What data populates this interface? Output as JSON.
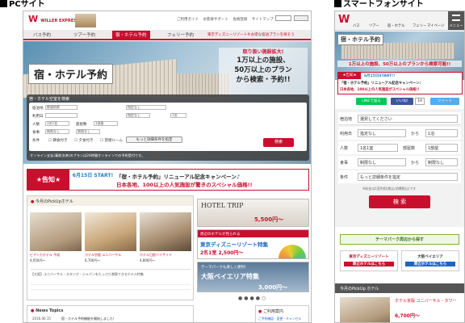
{
  "headings": {
    "pc": "PCサイト",
    "sp": "スマートフォンサイト"
  },
  "pc": {
    "logo": "WILLER EXPRESS",
    "top_links": [
      "ご利用ガイド",
      "お客様サポート",
      "会員登録",
      "サイトマップ"
    ],
    "nav": [
      "バス予約",
      "ツアー予約",
      "宿・ホテル予約",
      "フェリー予約",
      "東京ディズニーリゾート®お得な宿泊プランを探そう"
    ],
    "hero": {
      "title": "宿・ホテル予約",
      "promo": [
        "取り扱い施設拡大!",
        "1万以上の施設、",
        "50万以上のプラン",
        "から検索・予約!!"
      ]
    },
    "search": {
      "title": "宿・ホテル空室を検索",
      "fields": {
        "pref_label": "宿泊地",
        "pref_value": "都道府県",
        "area_value": "指定なし",
        "date_label": "利用日",
        "date_value": "指定なし",
        "nights_value": "1泊",
        "people_label": "人数",
        "people_value": "1名1室",
        "rooms_label": "部屋数",
        "rooms_value": "1部屋",
        "meal_label": "食事",
        "meal_value": "制限なし",
        "budget_value": "制限なし",
        "cond_label": "条件",
        "cond_values": [
          "朝食付き",
          "夕食付き",
          "禁煙ルーム"
        ],
        "more": "もっと詳細条件を指定"
      },
      "button": "検索",
      "note": "オンライン支払(事前決済)のプランは24時間オンラインでの予約受付です。"
    },
    "banner": {
      "tag": "★告知★",
      "date": "6月15日 START!",
      "line1": "「宿・ホテル予約」リニューアル記念キャンペーン♪",
      "line2": "日本各地、100以上の人気施設が驚きのスペシャル価格!!"
    },
    "pickup": {
      "title": "今月のPickUpホテル",
      "items": [
        {
          "name": "ビアンカホテル 平成",
          "price": "4,050円〜"
        },
        {
          "name": "ホテル京阪 ユニバーサル",
          "price": "6,700円〜"
        },
        {
          "name": "ホテル日航ベイサイド",
          "price": "4,800円〜"
        }
      ],
      "desc": "【大阪】ユニバーサル・スタジオ・ジャパンをたっぷり満喫できるホテル特集"
    },
    "side_banners": {
      "hoteltrip": "HOTEL TRIP",
      "hoteltrip_price": "5,500円〜",
      "disney_head": "周辺のホテルが見られる",
      "disney_title": "東京ディズニーリゾート特集",
      "disney_price": "2名1室 2,500円〜",
      "osaka_head": "テーマパークも楽しく便利!",
      "osaka_title": "大阪ベイエリア特集",
      "osaka_price": "3,000円〜"
    },
    "news": {
      "title": "News Topics",
      "date": "2016.06.15",
      "text": "宿・ホテル予約機能を開始しました!"
    },
    "guide": {
      "title": "ご利用案内",
      "link": "ご予約確認・変更・キャンセル"
    }
  },
  "sp": {
    "logo": "W",
    "tabs": [
      "バス",
      "ツアー",
      "宿・ホテル",
      "フェリー",
      "マイページ",
      "メニュー"
    ],
    "hero_title": "宿・ホテル予約",
    "hero_promo": "1万以上の施設、50万以上のプランから検索可能!!",
    "banner": {
      "tag": "★告知★",
      "date": "6月15日START!!",
      "line1": "「宿・ホテル予約」リニューアル記念キャンペーン♪",
      "line2": "日本各地、100以上の人気施設がスペシャル価格!!"
    },
    "social": {
      "line": "LINEで送る",
      "fb": "いいね!",
      "count": "19",
      "tw": "ツイート"
    },
    "form": {
      "rows": [
        {
          "label": "宿泊地",
          "value": "選択してください"
        },
        {
          "label": "利用日",
          "value": "指定なし",
          "mid": "から",
          "right": "1泊"
        },
        {
          "label": "人数",
          "value": "1名1室",
          "mid": "部屋数",
          "right": "1部屋"
        },
        {
          "label": "食事",
          "value": "制限なし",
          "mid": "から",
          "right": "制限なし"
        },
        {
          "label": "条件",
          "value": "もっと詳細条件を指定"
        }
      ],
      "note": "※料金は1室利用(税込/消費税込)です",
      "button": "検 索"
    },
    "theme_btn": "テーマパーク周辺から探す",
    "theme": [
      {
        "line1": "東京ディズニーリゾート",
        "line2": "周辺ホテルはこちら"
      },
      {
        "line1": "大阪ベイエリア",
        "line2": "周辺ホテルはこちら"
      }
    ],
    "pickup_title": "今月のPickUp ホテル",
    "pickup_item": {
      "name": "ホテル京阪 ユニバーサル・タワー",
      "price": "6,700円〜"
    }
  },
  "colors": {
    "brand": "#c8102e",
    "green": "#7bb33b"
  }
}
